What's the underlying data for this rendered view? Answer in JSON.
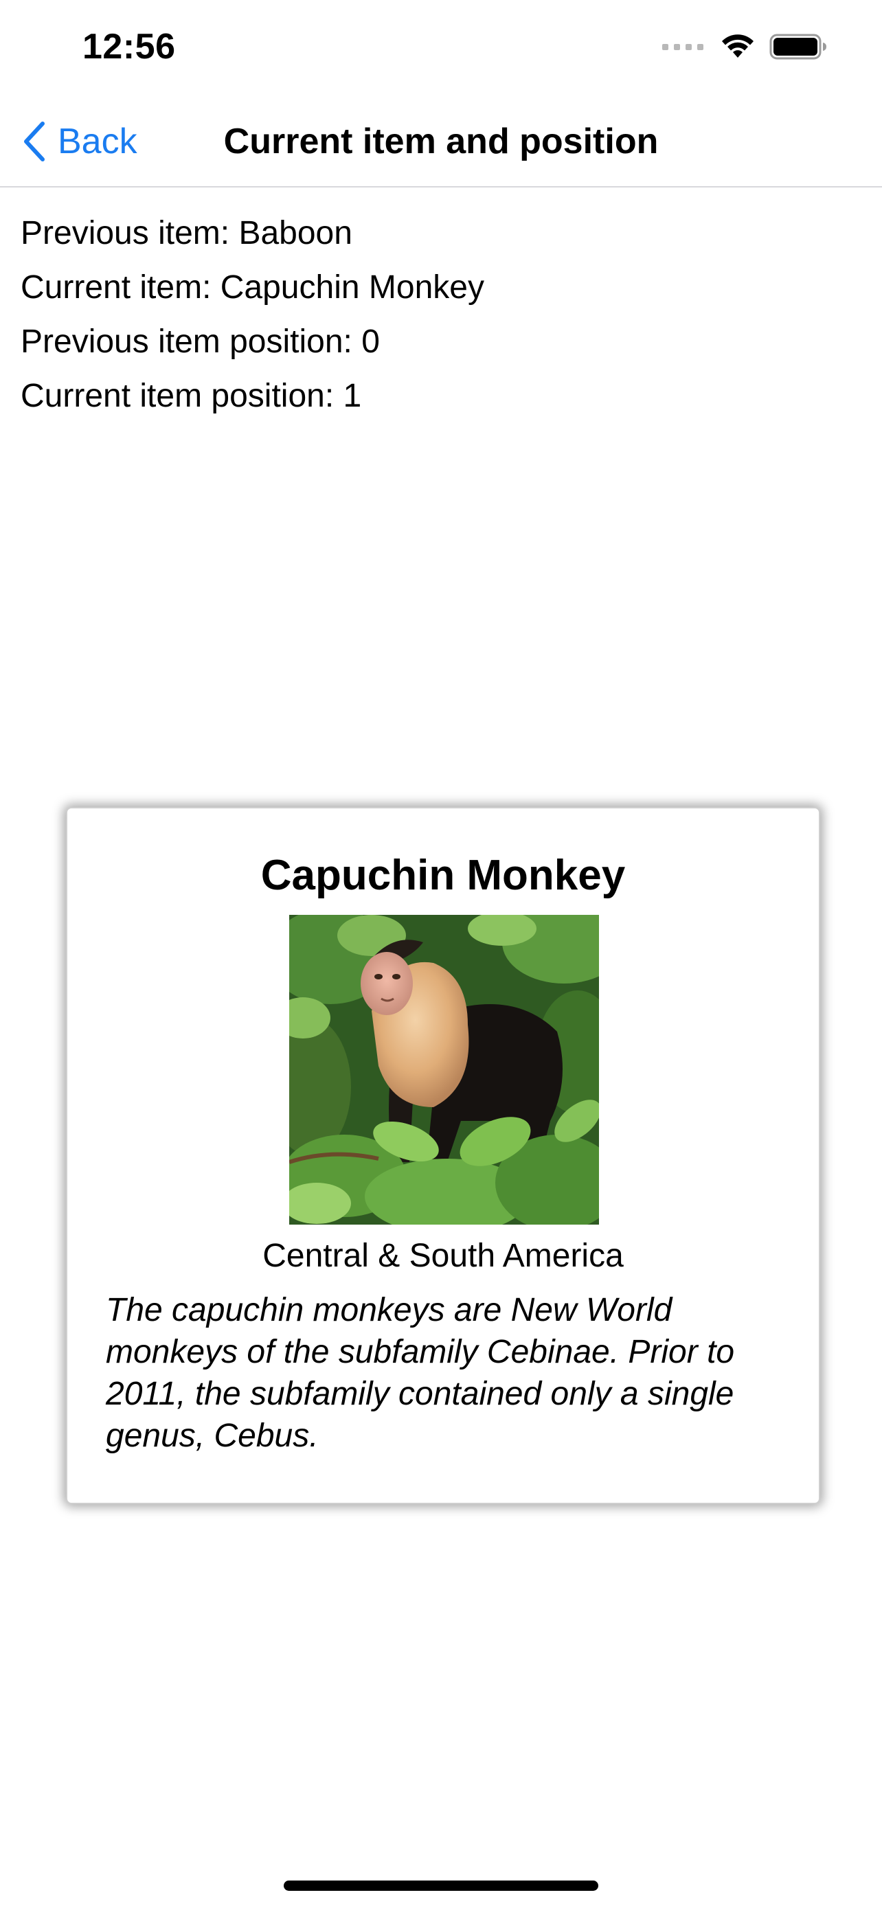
{
  "status_bar": {
    "time": "12:56",
    "icons": [
      "cellular-signal-icon",
      "wifi-icon",
      "battery-icon"
    ]
  },
  "nav": {
    "back_label": "Back",
    "title": "Current item and position",
    "accent_color": "#1a7cf0"
  },
  "info": {
    "previous_item": "Previous item: Baboon",
    "current_item": "Current item: Capuchin Monkey",
    "previous_position": "Previous item position: 0",
    "current_position": "Current item position: 1"
  },
  "card": {
    "title": "Capuchin Monkey",
    "image_alt": "Capuchin Monkey",
    "location": "Central & South America",
    "description": "The capuchin monkeys are New World monkeys of the subfamily Cebinae. Prior to 2011, the subfamily contained only a single genus, Cebus."
  }
}
